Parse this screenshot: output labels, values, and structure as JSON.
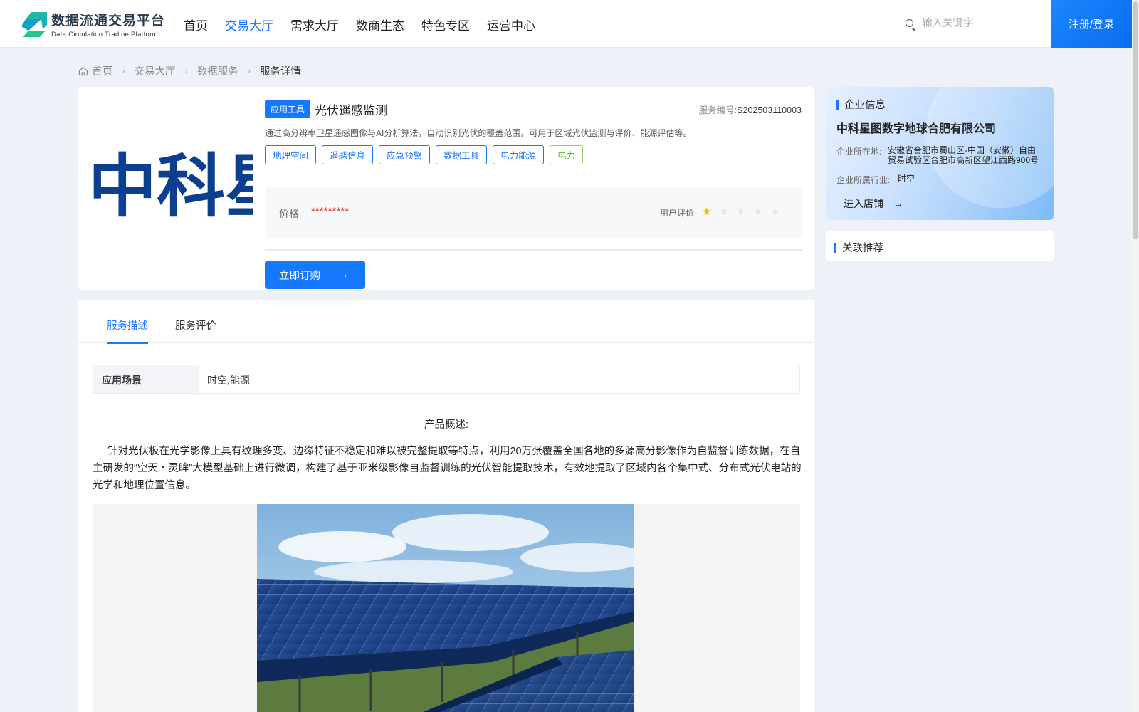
{
  "header": {
    "logo_title": "数据流通交易平台",
    "logo_subtitle": "Data Circulation Tradine Platform",
    "nav": [
      "首页",
      "交易大厅",
      "需求大厅",
      "数商生态",
      "特色专区",
      "运营中心"
    ],
    "nav_active": 1,
    "search_placeholder": "输入关键字",
    "login_label": "注册/登录"
  },
  "breadcrumb": [
    "首页",
    "交易大厅",
    "数据服务",
    "服务详情"
  ],
  "product": {
    "type_badge": "应用工具",
    "title": "光伏遥感监测",
    "service_no_label": "服务编号:",
    "service_no": "S202503110003",
    "description": "通过高分辨率卫星遥感图像与AI分析算法，自动识别光伏的覆盖范围。可用于区域光伏监测与评价、能源评估等。",
    "tags": [
      "地理空间",
      "遥感信息",
      "应急预警",
      "数据工具",
      "电力能源",
      "电力"
    ],
    "price_label": "价格",
    "price_value": "*********",
    "rating_label": "用户评价",
    "rating": 1,
    "rating_max": 5,
    "buy_label": "立即订购",
    "logo_text": "中科星"
  },
  "enterprise": {
    "section_title": "企业信息",
    "name": "中科星图数字地球合肥有限公司",
    "address_label": "企业所在地:",
    "address": "安徽省合肥市蜀山区-中国（安徽）自由贸易试验区合肥市高新区望江西路900号",
    "industry_label": "企业所属行业:",
    "industry": "时空",
    "shop_label": "进入店铺"
  },
  "recommend": {
    "section_title": "关联推荐"
  },
  "tabs": [
    "服务描述",
    "服务评价"
  ],
  "tab_active": 0,
  "detail": {
    "scene_label": "应用场景",
    "scene_value": "时空,能源",
    "overview_title": "产品概述:",
    "overview_text": "针对光伏板在光学影像上具有纹理多变、边缘特征不稳定和难以被完整提取等特点，利用20万张覆盖全国各地的多源高分影像作为自监督训练数据，在自主研发的“空天・灵眸”大模型基础上进行微调，构建了基于亚米级影像自监督训练的光伏智能提取技术，有效地提取了区域内各个集中式、分布式光伏电站的光学和地理位置信息。"
  },
  "colors": {
    "primary": "#1677ff",
    "price": "#e8504e",
    "star": "#f5b700",
    "green_tag": "#52c41a"
  }
}
